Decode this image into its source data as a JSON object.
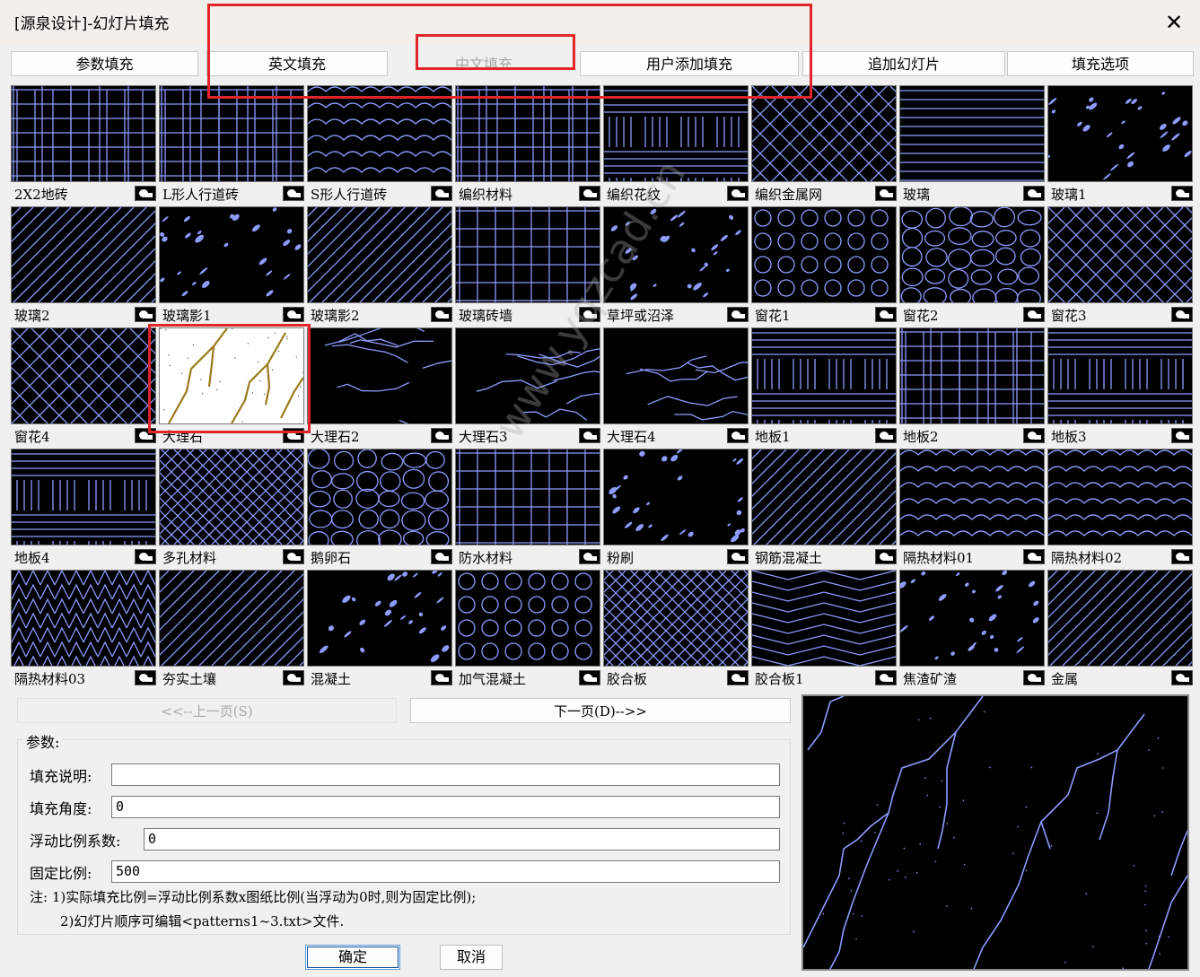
{
  "window": {
    "title": "[源泉设计]-幻灯片填充"
  },
  "tabs": [
    {
      "label": "参数填充",
      "disabled": false
    },
    {
      "label": "英文填充",
      "disabled": false
    },
    {
      "label": "中文填充",
      "disabled": true
    },
    {
      "label": "用户添加填充",
      "disabled": false
    },
    {
      "label": "追加幻灯片",
      "disabled": false
    },
    {
      "label": "填充选项",
      "disabled": false
    }
  ],
  "patterns": [
    {
      "label": "2X2地砖",
      "icon": "brick-pattern"
    },
    {
      "label": "L形人行道砖",
      "icon": "brick-pattern"
    },
    {
      "label": "S形人行道砖",
      "icon": "wave-pattern"
    },
    {
      "label": "编织材料",
      "icon": "brick-pattern"
    },
    {
      "label": "编织花纹",
      "icon": "weave-pattern"
    },
    {
      "label": "编织金属网",
      "icon": "diamond-pattern"
    },
    {
      "label": "玻璃",
      "icon": "horizontal-lines-pattern"
    },
    {
      "label": "玻璃1",
      "icon": "dots-pattern"
    },
    {
      "label": "玻璃2",
      "icon": "diagonal-pattern"
    },
    {
      "label": "玻璃影1",
      "icon": "dots-pattern"
    },
    {
      "label": "玻璃影2",
      "icon": "diagonal-pattern"
    },
    {
      "label": "玻璃砖墙",
      "icon": "grid-pattern"
    },
    {
      "label": "草坪或沼泽",
      "icon": "dots-pattern"
    },
    {
      "label": "窗花1",
      "icon": "circle-pattern"
    },
    {
      "label": "窗花2",
      "icon": "stone-pattern"
    },
    {
      "label": "窗花3",
      "icon": "diamond-pattern"
    },
    {
      "label": "窗花4",
      "icon": "diamond-pattern"
    },
    {
      "label": "大理石",
      "icon": "marble-pattern"
    },
    {
      "label": "大理石2",
      "icon": "crack-pattern"
    },
    {
      "label": "大理石3",
      "icon": "crack-pattern"
    },
    {
      "label": "大理石4",
      "icon": "crack-pattern"
    },
    {
      "label": "地板1",
      "icon": "weave-pattern"
    },
    {
      "label": "地板2",
      "icon": "brick-pattern"
    },
    {
      "label": "地板3",
      "icon": "weave-pattern"
    },
    {
      "label": "地板4",
      "icon": "weave-pattern"
    },
    {
      "label": "多孔材料",
      "icon": "crosshatch-pattern"
    },
    {
      "label": "鹅卵石",
      "icon": "stone-pattern"
    },
    {
      "label": "防水材料",
      "icon": "grid-pattern"
    },
    {
      "label": "粉刷",
      "icon": "dots-pattern"
    },
    {
      "label": "钢筋混凝土",
      "icon": "diagonal-pattern"
    },
    {
      "label": "隔热材料01",
      "icon": "wave-pattern"
    },
    {
      "label": "隔热材料02",
      "icon": "wave-pattern"
    },
    {
      "label": "隔热材料03",
      "icon": "triangle-pattern"
    },
    {
      "label": "夯实土壤",
      "icon": "diagonal-pattern"
    },
    {
      "label": "混凝土",
      "icon": "dots-pattern"
    },
    {
      "label": "加气混凝土",
      "icon": "circle-pattern"
    },
    {
      "label": "胶合板",
      "icon": "crosshatch-pattern"
    },
    {
      "label": "胶合板1",
      "icon": "chevron-pattern"
    },
    {
      "label": "焦渣矿渣",
      "icon": "dots-pattern"
    },
    {
      "label": "金属",
      "icon": "diagonal-pattern"
    }
  ],
  "nav": {
    "prev_label": "<<--上一页(S)",
    "next_label": "下一页(D)-->>"
  },
  "params": {
    "group_title": "参数:",
    "desc_label": "填充说明:",
    "desc_value": "",
    "angle_label": "填充角度:",
    "angle_value": "0",
    "float_label": "浮动比例系数:",
    "float_value": "0",
    "fixed_label": "固定比例:",
    "fixed_value": "500",
    "note1": "注: 1)实际填充比例=浮动比例系数x图纸比例(当浮动为0时,则为固定比例);",
    "note2": "2)幻灯片顺序可编辑<patterns1~3.txt>文件."
  },
  "actions": {
    "ok_label": "确定",
    "cancel_label": "取消"
  },
  "watermark": "www.yqzcad.cn",
  "colors": {
    "pattern": "#8f9bff",
    "selected": "#9a7a1c",
    "highlight": "#e1262b"
  }
}
